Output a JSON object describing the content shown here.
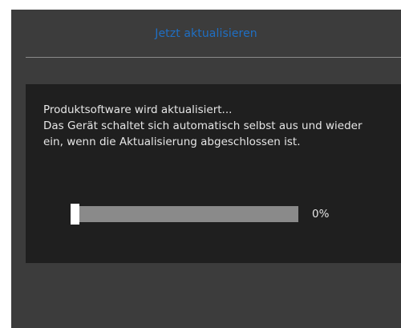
{
  "header": {
    "title": "Jetzt aktualisieren"
  },
  "dialog": {
    "line1": "Produktsoftware wird aktualisiert...",
    "line2": "Das Gerät schaltet sich automatisch selbst aus und wieder",
    "line3": "ein, wenn die Aktualisierung abgeschlossen ist."
  },
  "progress": {
    "value": 0,
    "label": "0%"
  },
  "colors": {
    "title": "#1f6fc4",
    "screen_bg": "#3c3c3c",
    "panel_bg": "#1f1f1f",
    "track": "#8a8a8a",
    "fill": "#ffffff"
  }
}
